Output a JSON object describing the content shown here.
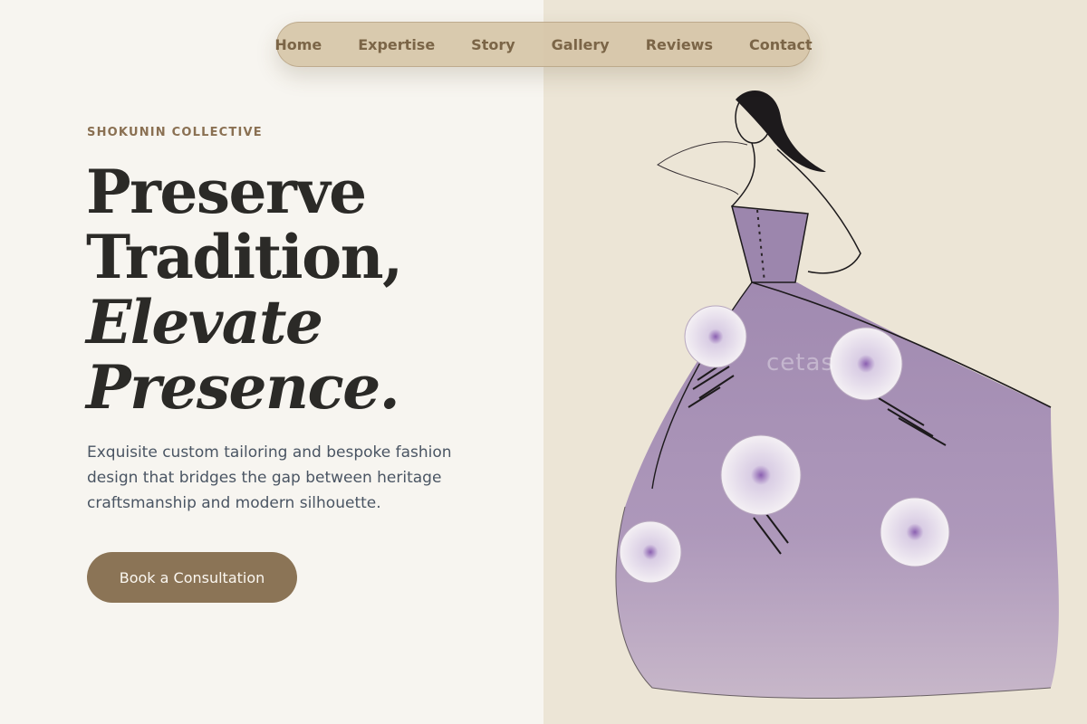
{
  "nav": {
    "items": [
      "Home",
      "Expertise",
      "Story",
      "Gallery",
      "Reviews",
      "Contact"
    ]
  },
  "hero": {
    "eyebrow": "SHOKUNIN COLLECTIVE",
    "headline_line1": "Preserve",
    "headline_line2": "Tradition,",
    "headline_line3": "Elevate",
    "headline_line4": "Presence.",
    "description": "Exquisite custom tailoring and bespoke fashion design that bridges the gap between heritage craftsmanship and modern silhouette.",
    "cta_label": "Book a Consultation"
  },
  "illustration": {
    "subject": "fashion-sketch-purple-ball-gown",
    "watermark": "cetas"
  },
  "colors": {
    "accent": "#8b7456",
    "nav_bg": "#d6c6a8",
    "gown": "#9c86ad",
    "page_bg": "#f7f5f0"
  }
}
